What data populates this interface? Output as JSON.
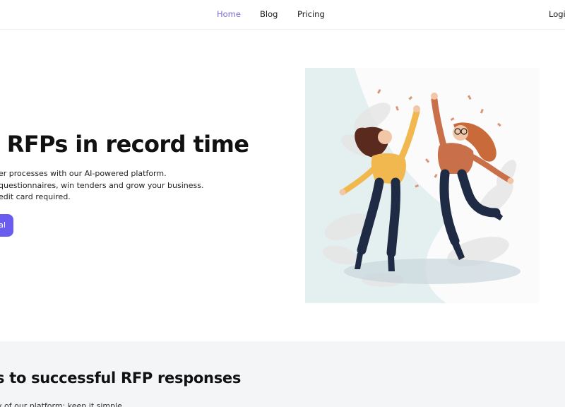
{
  "nav": {
    "home": "Home",
    "blog": "Blog",
    "pricing": "Pricing",
    "login": "Login"
  },
  "hero": {
    "title": "r RFPs in record time",
    "lines": [
      "er processes with our AI-powered platform.",
      "questionnaires, win tenders and grow your business.",
      "edit card required."
    ],
    "cta_label": "al"
  },
  "section": {
    "title": "s to successful RFP responses",
    "text": "y of our platform: keep it simple."
  },
  "colors": {
    "accent": "#6b5cf0",
    "nav_active": "#7a6fd0",
    "section_bg": "#f3f5f7"
  },
  "icons": {
    "illustration": "two-women-jumping-celebration-illustration"
  }
}
